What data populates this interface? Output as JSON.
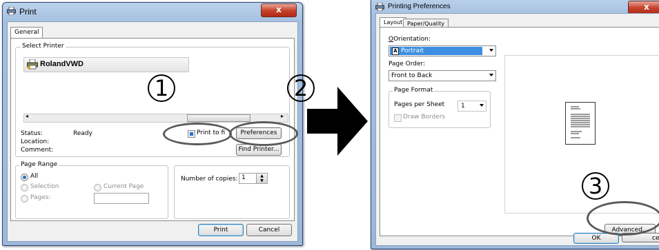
{
  "print_dialog": {
    "title": "Print",
    "close_label": "x",
    "tab_general": "General",
    "select_printer_label": "Select Printer",
    "printer_name": "RolandVWD",
    "status_label": "Status:",
    "status_value": "Ready",
    "location_label": "Location:",
    "comment_label": "Comment:",
    "print_to_file_label": "Print to fi",
    "preferences_button": "Preferences",
    "find_printer_button": "Find Printer...",
    "page_range_label": "Page Range",
    "range_all": "All",
    "range_selection": "Selection",
    "range_current_page": "Current Page",
    "range_pages": "Pages:",
    "copies_label": "Number of copies:",
    "copies_value": "1",
    "print_button": "Print",
    "cancel_button": "Cancel"
  },
  "prefs_dialog": {
    "title": "Printing Preferences",
    "close_label": "x",
    "tab_layout": "Layout",
    "tab_paper_quality": "Paper/Quality",
    "orientation_label": "Orientation:",
    "orientation_value": "Portrait",
    "page_order_label": "Page Order:",
    "page_order_value": "Front to Back",
    "page_format_label": "Page Format",
    "pages_per_sheet_label": "Pages per Sheet",
    "pages_per_sheet_value": "1",
    "draw_borders_label": "Draw Borders",
    "advanced_button": "Advanced...",
    "ok_button": "OK",
    "cancel_button_partial": "cel"
  },
  "callouts": {
    "step1": "1",
    "step2": "2",
    "step3": "3"
  },
  "colors": {
    "accent": "#2b6fc8",
    "window_frame": "#a4bfe0",
    "close_button": "#c8442e",
    "callout_ring": "#5a5a5a"
  }
}
